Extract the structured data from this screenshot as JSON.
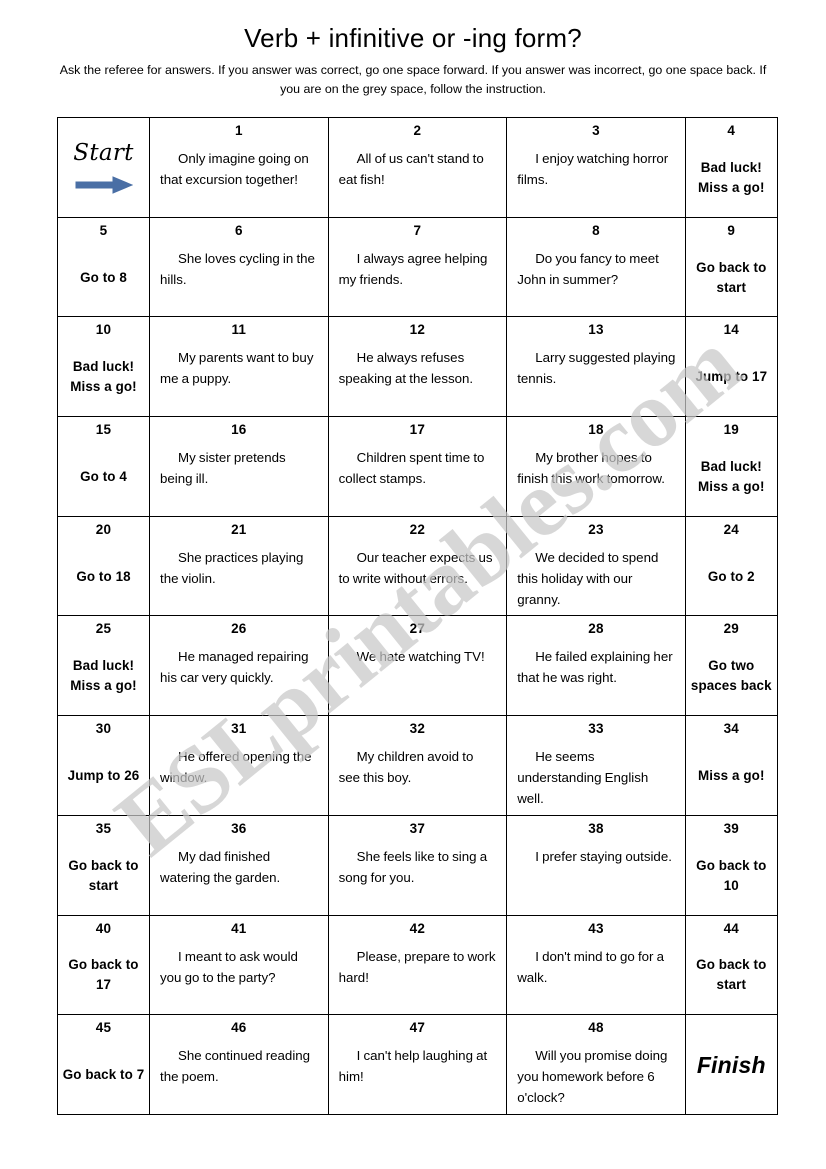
{
  "header": {
    "title": "Verb + infinitive or -ing form?",
    "instructions": "Ask the referee for answers. If you answer was correct, go one space forward. If you answer was incorrect, go one space back. If you are on the grey space, follow the instruction."
  },
  "watermark": {
    "text": "ESLprintables.com",
    "color": "#c9c9c9"
  },
  "colors": {
    "grey_cell_bg": "#edeae0",
    "white_cell_bg": "#ffffff",
    "border": "#000000",
    "arrow": "#4a6fa5",
    "text": "#000000"
  },
  "board": {
    "start_label": "Start",
    "start_arrow_icon": "right-arrow-icon",
    "finish_label": "Finish",
    "rows": [
      [
        {
          "kind": "start",
          "label": "Start"
        },
        {
          "kind": "sentence",
          "num": "1",
          "text": "Only imagine going on that excursion together!"
        },
        {
          "kind": "sentence",
          "num": "2",
          "text": "All of us can't stand to eat fish!"
        },
        {
          "kind": "sentence",
          "num": "3",
          "text": "I enjoy watching horror films."
        },
        {
          "kind": "instruction",
          "num": "4",
          "text": "Bad luck! Miss a go!"
        }
      ],
      [
        {
          "kind": "instruction",
          "num": "5",
          "text": "Go to 8"
        },
        {
          "kind": "sentence",
          "num": "6",
          "text": "She loves cycling in the hills."
        },
        {
          "kind": "sentence",
          "num": "7",
          "text": "I always agree helping my friends."
        },
        {
          "kind": "sentence",
          "num": "8",
          "text": "Do you fancy to meet John in summer?"
        },
        {
          "kind": "instruction",
          "num": "9",
          "text": "Go back to start"
        }
      ],
      [
        {
          "kind": "instruction",
          "num": "10",
          "text": "Bad luck! Miss a go!"
        },
        {
          "kind": "sentence",
          "num": "11",
          "text": "My parents want to buy me a puppy."
        },
        {
          "kind": "sentence",
          "num": "12",
          "text": "He always refuses speaking at the lesson."
        },
        {
          "kind": "sentence",
          "num": "13",
          "text": "Larry suggested playing tennis."
        },
        {
          "kind": "instruction",
          "num": "14",
          "text": "Jump to 17"
        }
      ],
      [
        {
          "kind": "instruction",
          "num": "15",
          "text": "Go to 4"
        },
        {
          "kind": "sentence",
          "num": "16",
          "text": "My sister pretends being ill."
        },
        {
          "kind": "sentence",
          "num": "17",
          "text": "Children spent time to collect stamps."
        },
        {
          "kind": "sentence",
          "num": "18",
          "text": "My brother hopes to finish this work tomorrow."
        },
        {
          "kind": "instruction",
          "num": "19",
          "text": "Bad luck! Miss a go!"
        }
      ],
      [
        {
          "kind": "instruction",
          "num": "20",
          "text": "Go to 18"
        },
        {
          "kind": "sentence",
          "num": "21",
          "text": "She practices playing the violin."
        },
        {
          "kind": "sentence",
          "num": "22",
          "text": "Our teacher expects us to write without errors."
        },
        {
          "kind": "sentence",
          "num": "23",
          "text": "We decided to spend this holiday with our granny."
        },
        {
          "kind": "instruction",
          "num": "24",
          "text": "Go to 2"
        }
      ],
      [
        {
          "kind": "instruction",
          "num": "25",
          "text": "Bad luck! Miss a go!"
        },
        {
          "kind": "sentence",
          "num": "26",
          "text": "He managed repairing his car very quickly."
        },
        {
          "kind": "sentence",
          "num": "27",
          "text": "We hate watching TV!"
        },
        {
          "kind": "sentence",
          "num": "28",
          "text": "He failed explaining her that he was right."
        },
        {
          "kind": "instruction",
          "num": "29",
          "text": "Go two spaces back"
        }
      ],
      [
        {
          "kind": "instruction",
          "num": "30",
          "text": "Jump to 26"
        },
        {
          "kind": "sentence",
          "num": "31",
          "text": "He offered opening the window."
        },
        {
          "kind": "sentence",
          "num": "32",
          "text": "My children avoid to see this boy."
        },
        {
          "kind": "sentence",
          "num": "33",
          "text": "He seems understanding English well."
        },
        {
          "kind": "instruction",
          "num": "34",
          "text": "Miss a go!"
        }
      ],
      [
        {
          "kind": "instruction",
          "num": "35",
          "text": "Go back to start"
        },
        {
          "kind": "sentence",
          "num": "36",
          "text": "My dad finished watering the garden."
        },
        {
          "kind": "sentence",
          "num": "37",
          "text": "She feels like to sing a song for you."
        },
        {
          "kind": "sentence",
          "num": "38",
          "text": "I prefer staying outside."
        },
        {
          "kind": "instruction",
          "num": "39",
          "text": "Go back to 10"
        }
      ],
      [
        {
          "kind": "instruction",
          "num": "40",
          "text": "Go back to 17"
        },
        {
          "kind": "sentence",
          "num": "41",
          "text": "I meant to ask would you go to the party?"
        },
        {
          "kind": "sentence",
          "num": "42",
          "text": "Please, prepare to work hard!"
        },
        {
          "kind": "sentence",
          "num": "43",
          "text": "I don't mind to go for a walk."
        },
        {
          "kind": "instruction",
          "num": "44",
          "text": "Go back to start"
        }
      ],
      [
        {
          "kind": "instruction",
          "num": "45",
          "text": "Go back to 7"
        },
        {
          "kind": "sentence",
          "num": "46",
          "text": "She continued reading the poem."
        },
        {
          "kind": "sentence",
          "num": "47",
          "text": "I can't help laughing at him!"
        },
        {
          "kind": "sentence",
          "num": "48",
          "text": "Will you promise doing you homework before 6 o'clock?"
        },
        {
          "kind": "finish",
          "label": "Finish"
        }
      ]
    ]
  }
}
